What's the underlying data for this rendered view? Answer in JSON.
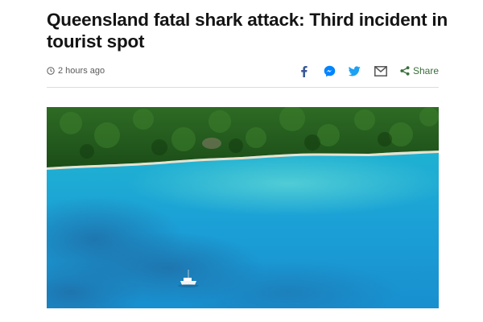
{
  "article": {
    "headline": "Queensland fatal shark attack: Third incident in tourist spot",
    "timestamp": "2 hours ago"
  },
  "share": {
    "icons": [
      "facebook-icon",
      "messenger-icon",
      "twitter-icon",
      "email-icon",
      "share-icon"
    ],
    "label": "Share"
  },
  "colors": {
    "headline": "#141414",
    "timestamp": "#5a5a5a",
    "facebook": "#3b5998",
    "messenger": "#0084ff",
    "twitter": "#1da1f2",
    "email": "#555555",
    "share_accent": "#3a6d3a",
    "water": "#1fa6d4",
    "forest": "#1e5a1c"
  }
}
